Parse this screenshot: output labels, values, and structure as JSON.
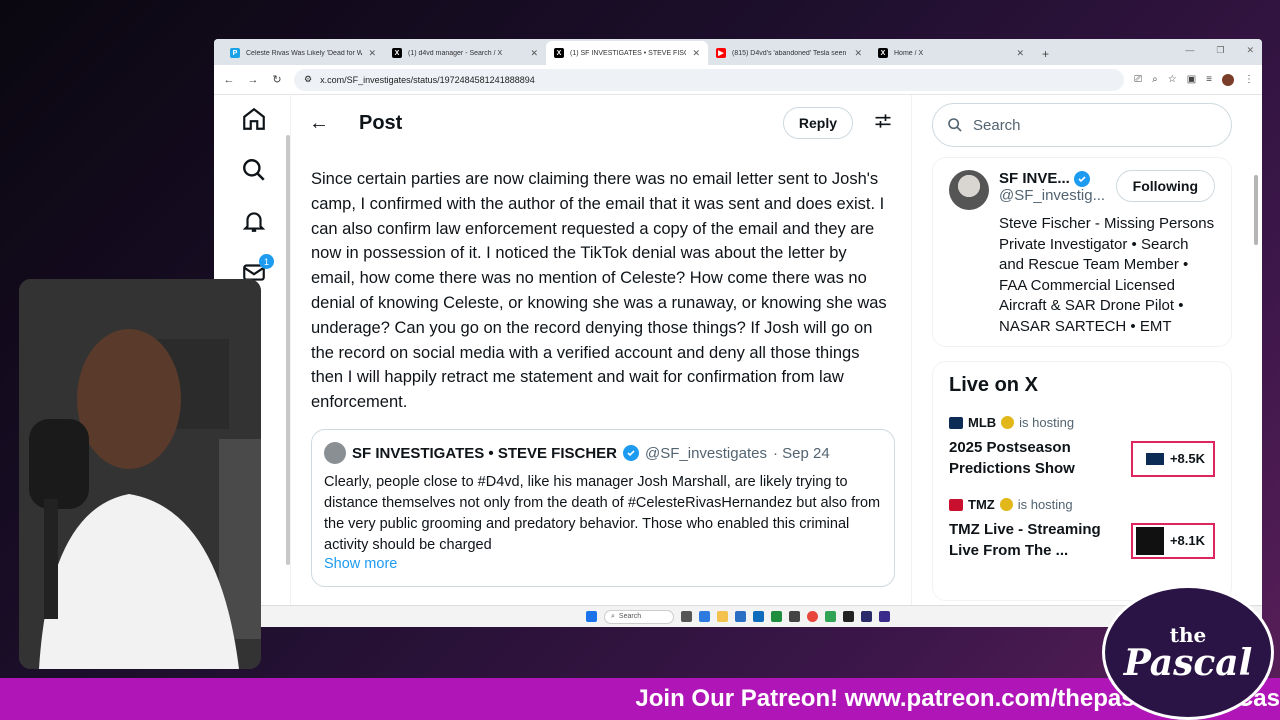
{
  "browser": {
    "tabs": [
      {
        "title": "Celeste Rivas Was Likely 'Dead for We",
        "icon": "p-favicon",
        "color": "#1aa1e6"
      },
      {
        "title": "(1) d4vd manager - Search / X",
        "icon": "x-favicon",
        "color": "#000000"
      },
      {
        "title": "(1) SF INVESTIGATES • STEVE FISCHER",
        "icon": "x-favicon",
        "color": "#000000",
        "active": true
      },
      {
        "title": "(815) D4vd's 'abandoned' Tesla seen",
        "icon": "youtube-favicon",
        "color": "#ff0000"
      },
      {
        "title": "Home / X",
        "icon": "x-favicon",
        "color": "#000000"
      }
    ],
    "url": "x.com/SF_investigates/status/1972484581241888894"
  },
  "header": {
    "title": "Post",
    "reply_label": "Reply"
  },
  "nav": {
    "notifications_badge": "1"
  },
  "post": {
    "text": "Since certain parties are now claiming there was no email letter sent to Josh's camp,  I confirmed with the author of the email that it was sent and does exist. I can also confirm law enforcement requested a copy of the email and they are now in possession of it. I noticed the TikTok denial was about the letter by email, how come there was no mention of Celeste? How come there was no denial of knowing Celeste, or knowing she was a runaway, or knowing she was underage? Can you go on the record denying those things? If Josh will go on the record on social media with a verified account and deny all those things then I will happily retract me statement and wait for confirmation from law enforcement."
  },
  "quote": {
    "name": "SF INVESTIGATES • STEVE FISCHER",
    "handle": "@SF_investigates",
    "date": "· Sep 24",
    "text": "Clearly, people close to #D4vd, like his manager Josh Marshall, are likely trying to distance themselves not only from the death of #CelesteRivasHernandez but also from the very public grooming and predatory behavior. Those who enabled this criminal activity should be charged",
    "show_more": "Show more"
  },
  "sidebar": {
    "search_placeholder": "Search",
    "profile": {
      "name": "SF INVE...",
      "handle": "@SF_investig...",
      "follow_label": "Following",
      "bio": "Steve Fischer - Missing Persons Private Investigator • Search and Rescue Team Member • FAA Commercial Licensed Aircraft & SAR Drone Pilot • NASAR SARTECH • EMT"
    },
    "live": {
      "title": "Live on X",
      "items": [
        {
          "host": "MLB",
          "hosting": "is hosting",
          "title": "2025 Postseason Predictions Show",
          "count": "+8.5K"
        },
        {
          "host": "TMZ",
          "hosting": "is hosting",
          "title": "TMZ Live - Streaming Live From The ...",
          "count": "+8.1K"
        }
      ]
    }
  },
  "taskbar": {
    "search": "Search"
  },
  "overlay": {
    "banner": "Join Our Patreon! www.patreon.com/thepascalshow Cas",
    "logo_top": "the",
    "logo_bottom": "Pascal"
  },
  "colors": {
    "x_blue": "#1d9bf0",
    "banner": "#b015b8",
    "live_border": "#e0245e"
  }
}
